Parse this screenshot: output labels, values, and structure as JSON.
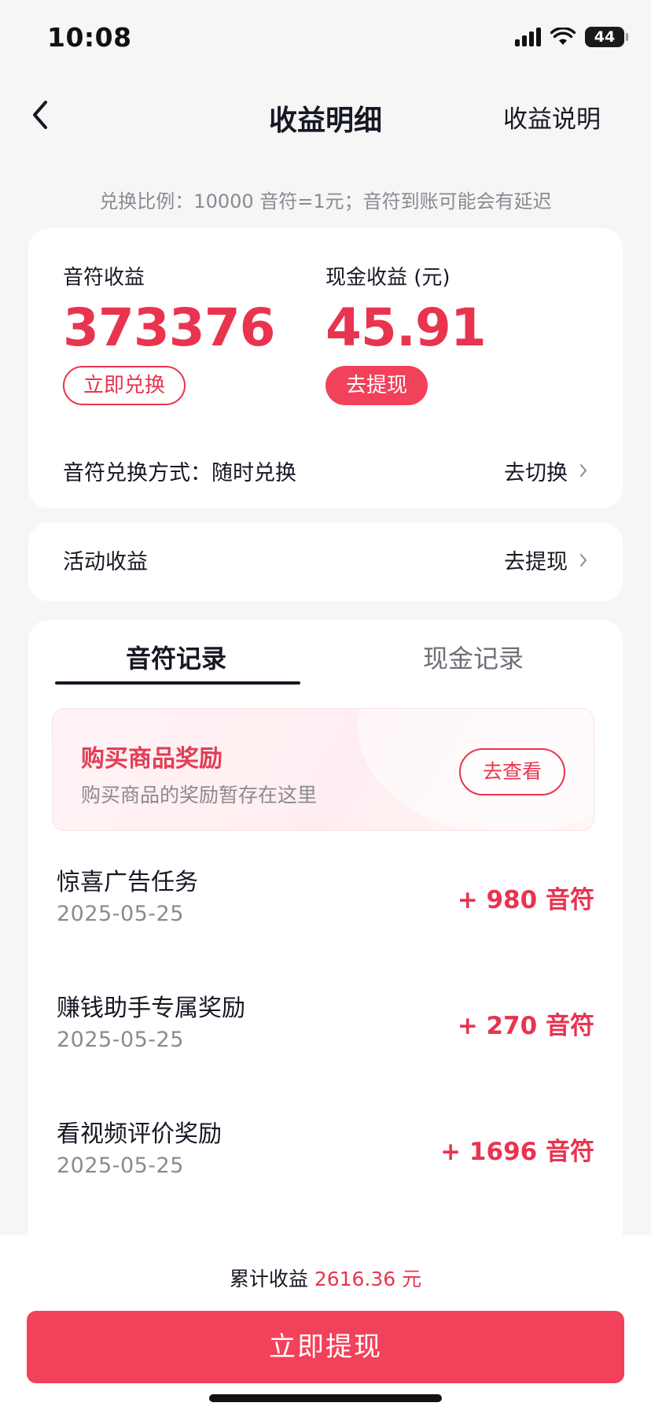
{
  "status_bar": {
    "time": "10:08",
    "battery": "44"
  },
  "nav": {
    "title": "收益明细",
    "action": "收益说明"
  },
  "exchange_tip": "兑换比例：10000 音符=1元；音符到账可能会有延迟",
  "earnings": {
    "notes_label": "音符收益",
    "notes_value": "373376",
    "notes_button": "立即兑换",
    "cash_label": "现金收益 (元)",
    "cash_value": "45.91",
    "cash_button": "去提现",
    "exchange_mode_label": "音符兑换方式：随时兑换",
    "exchange_mode_action": "去切换"
  },
  "activity": {
    "label": "活动收益",
    "action": "去提现"
  },
  "tabs": [
    {
      "label": "音符记录",
      "active": true
    },
    {
      "label": "现金记录",
      "active": false
    }
  ],
  "promo": {
    "title": "购买商品奖励",
    "desc": "购买商品的奖励暂存在这里",
    "button": "去查看"
  },
  "records": [
    {
      "title": "惊喜广告任务",
      "date": "2025-05-25",
      "amount": "+ 980 音符"
    },
    {
      "title": "赚钱助手专属奖励",
      "date": "2025-05-25",
      "amount": "+ 270 音符"
    },
    {
      "title": "看视频评价奖励",
      "date": "2025-05-25",
      "amount": "+ 1696 音符"
    }
  ],
  "bottom": {
    "total_label": "累计收益",
    "total_value": "2616.36 元",
    "withdraw_button": "立即提现"
  },
  "colors": {
    "accent": "#e8344f",
    "button": "#f2415a",
    "text": "#161823",
    "muted": "#8a8b91",
    "background": "#f6f6f7"
  }
}
